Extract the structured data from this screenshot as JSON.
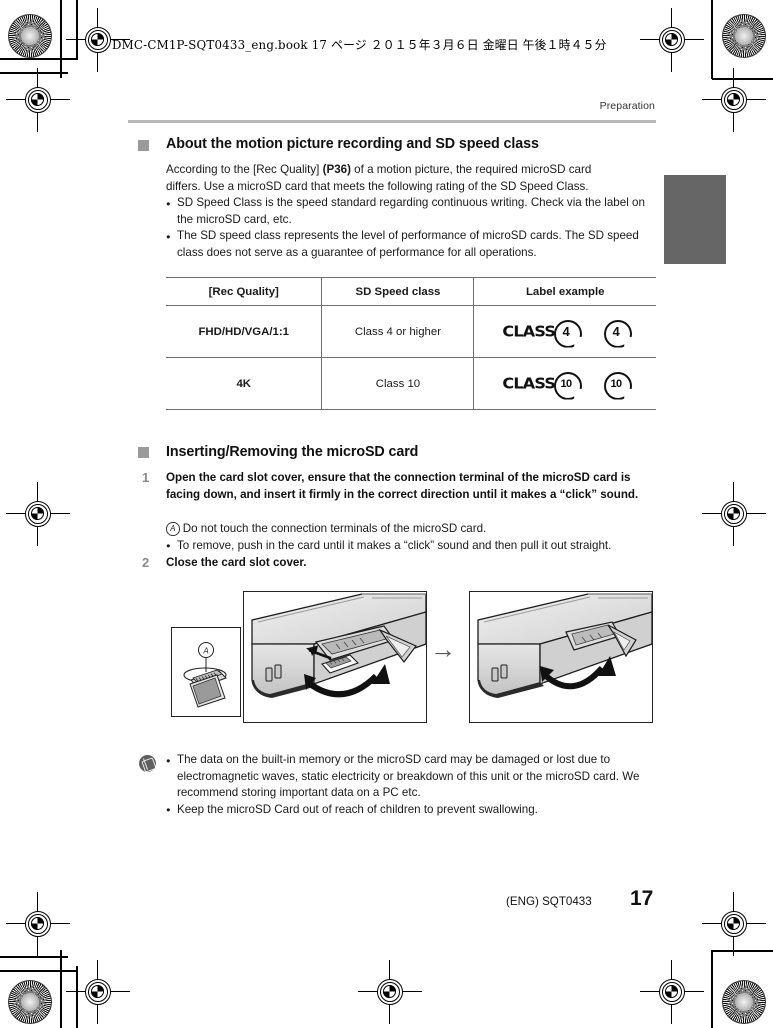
{
  "print_header": {
    "book_line": "DMC-CM1P-SQT0433_eng.book   17 ページ   ２０１５年３月６日   金曜日   午後１時４５分"
  },
  "running_head": "Preparation",
  "sections": [
    {
      "id": "sd-speed-class",
      "heading": "About the motion picture recording and SD speed class",
      "paragraph_lines": [
        "According to the [Rec Quality] (P36) of a motion picture, the required microSD card",
        "differs. Use a microSD card that meets the following rating of the SD Speed Class."
      ],
      "paragraph_bold_fragment": "(P36)",
      "bullets": [
        "SD Speed Class is the speed standard regarding continuous writing. Check via the label on the microSD card, etc.",
        "The SD speed class represents the level of performance of microSD cards. The SD speed class does not serve as a guarantee of performance for all operations."
      ]
    },
    {
      "id": "insert-remove",
      "heading": "Inserting/Removing the microSD card",
      "steps": [
        {
          "number": "1",
          "text": "Open the card slot cover, ensure that the connection terminal of the microSD card is facing down, and insert it firmly in the correct direction until it makes a “click” sound.",
          "sub_marked": {
            "marker": "A",
            "text": "Do not touch the connection terminals of the microSD card."
          },
          "sub_bullet": "To remove, push in the card until it makes a “click” sound and then pull it out straight."
        },
        {
          "number": "2",
          "text": "Close the card slot cover."
        }
      ]
    }
  ],
  "table": {
    "columns": [
      "[Rec Quality]",
      "SD Speed class",
      "Label example"
    ],
    "rows": [
      {
        "rec_quality": "FHD/HD/VGA/1:1",
        "speed_class": "Class 4 or higher",
        "label_word": "CLASS",
        "label_number": "4"
      },
      {
        "rec_quality": "4K",
        "speed_class": "Class 10",
        "label_word": "CLASS",
        "label_number": "10"
      }
    ]
  },
  "illustration": {
    "inset_marker": "A",
    "transition_arrow": "→",
    "left_caption": "",
    "right_caption": ""
  },
  "note": {
    "icon": "memo-icon",
    "bullets": [
      "The data on the built-in memory or the microSD card may be damaged or lost due to electromagnetic waves, static electricity or breakdown of this unit or the microSD card. We recommend storing important data on a PC etc.",
      "Keep the microSD Card out of reach of children to prevent swallowing."
    ]
  },
  "footer": {
    "doc_id": "(ENG) SQT0433",
    "page_number": "17"
  },
  "colors": {
    "rule": "#b9b9b9",
    "bullet_square": "#9a9a9a",
    "step_number": "#8a8a8a",
    "thumb_tab": "#666666",
    "table_line": "#6f6f6f"
  }
}
